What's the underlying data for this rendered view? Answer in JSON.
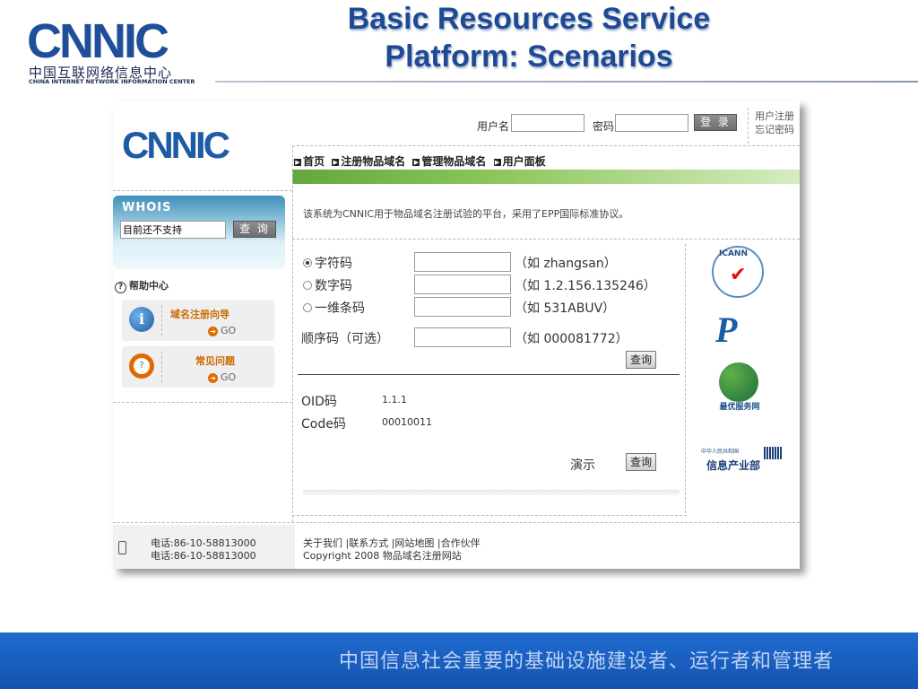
{
  "slide": {
    "logo_text": "CNNIC",
    "logo_cn": "中国互联网络信息中心",
    "logo_en": "CHINA INTERNET NETWORK INFORMATION CENTER",
    "title_line1": "Basic Resources Service",
    "title_line2": "Platform:  Scenarios",
    "slogan": "中国信息社会重要的基础设施建设者、运行者和管理者"
  },
  "header": {
    "logo_text": "CNNIC",
    "username_label": "用户名",
    "password_label": "密码",
    "username_value": "",
    "password_value": "",
    "login_button": "登 录",
    "register_link": "用户注册",
    "forgot_link": "忘记密码"
  },
  "nav": {
    "items": [
      "首页",
      "注册物品域名",
      "管理物品域名",
      "用户面板"
    ]
  },
  "description": "该系统为CNNIC用于物品域名注册试验的平台，采用了EPP国际标准协议。",
  "whois": {
    "title": "WHOIS",
    "input_value": "目前还不支持",
    "query_button": "查 询"
  },
  "help": {
    "title": "帮助中心",
    "cards": [
      {
        "label": "域名注册向导",
        "go": "GO",
        "icon": "info-arrow-icon"
      },
      {
        "label": "常见问题",
        "go": "GO",
        "icon": "lifebuoy-icon"
      }
    ]
  },
  "form": {
    "options": [
      {
        "label": "字符码",
        "example": "（如  zhangsan）",
        "selected": true
      },
      {
        "label": "数字码",
        "example": "（如  1.2.156.135246）",
        "selected": false
      },
      {
        "label": "一维条码",
        "example": "（如  531ABUV）",
        "selected": false
      }
    ],
    "sequence_label": "顺序码（可选）",
    "sequence_example": "（如  000081772）",
    "query_button": "查询",
    "result": {
      "oid_label": "OID码",
      "oid_value": "1.1.1",
      "code_label": "Code码",
      "code_value": "00010011"
    },
    "demo_label": "演示",
    "demo_button": "查询"
  },
  "partners": {
    "icann_text": "ICANN",
    "best_service_caption": "最优服务网",
    "mii_top": "中华人民共和国",
    "mii_text": "信息产业部"
  },
  "footer": {
    "phone1": "电话:86-10-58813000",
    "phone2": "电话:86-10-58813000",
    "links": "关于我们 |联系方式 |网站地图 |合作伙伴",
    "copyright": "Copyright 2008 物品域名注册网站"
  },
  "colors": {
    "brand_blue": "#1f4f9a",
    "title_blue": "#1f4a93",
    "nav_green": "#62a83d",
    "bottom_bar": "#1f6bd0"
  }
}
